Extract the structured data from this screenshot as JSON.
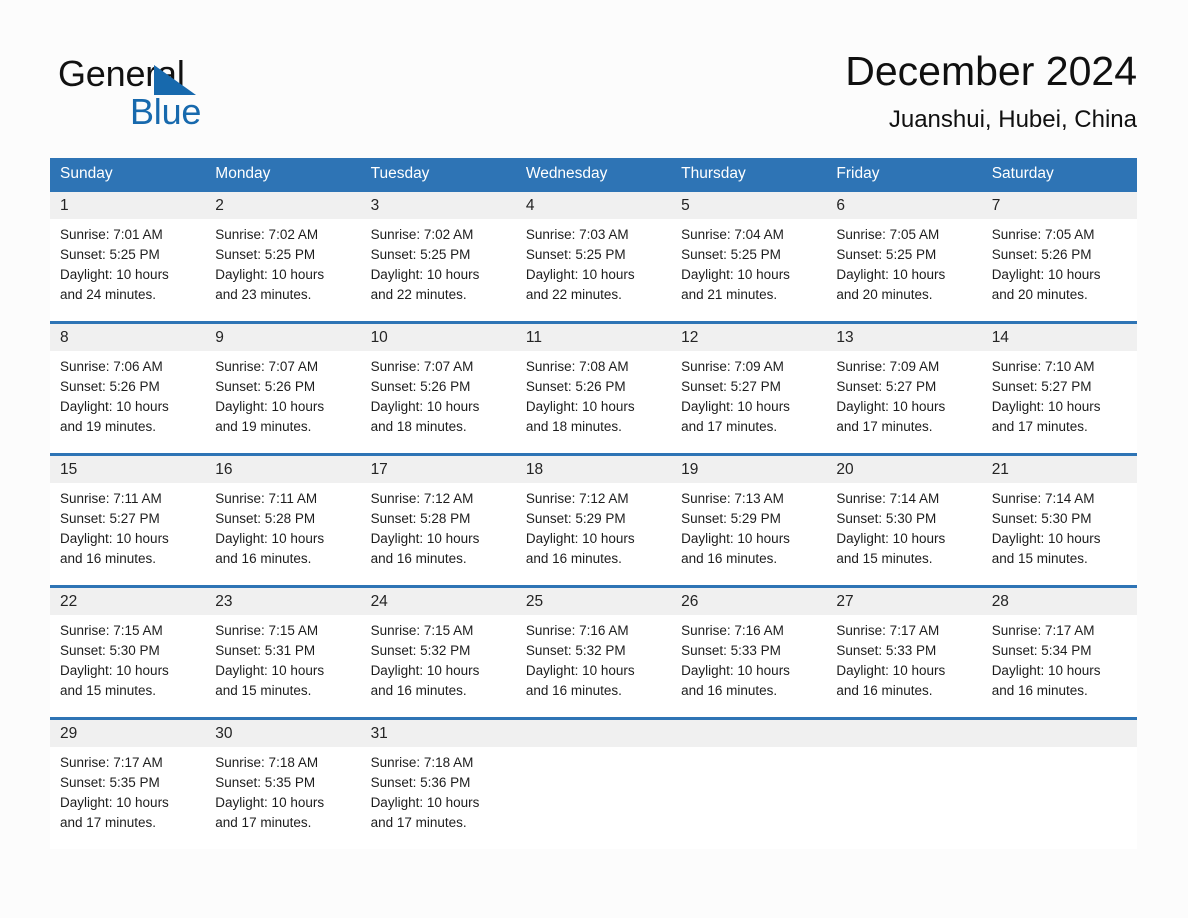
{
  "brand": {
    "name_part1": "General",
    "name_part2": "Blue",
    "triangle_color": "#1769ad"
  },
  "header": {
    "title": "December 2024",
    "subtitle": "Juanshui, Hubei, China"
  },
  "theme": {
    "header_blue": "#2e74b5",
    "daynum_band": "#f0f0f0",
    "page_background": "#fcfcfc",
    "text": "#1d1d1d"
  },
  "calendar": {
    "weekdays": [
      "Sunday",
      "Monday",
      "Tuesday",
      "Wednesday",
      "Thursday",
      "Friday",
      "Saturday"
    ],
    "weeks": [
      [
        {
          "day": "1",
          "sunrise": "Sunrise: 7:01 AM",
          "sunset": "Sunset: 5:25 PM",
          "daylight_l1": "Daylight: 10 hours",
          "daylight_l2": "and 24 minutes."
        },
        {
          "day": "2",
          "sunrise": "Sunrise: 7:02 AM",
          "sunset": "Sunset: 5:25 PM",
          "daylight_l1": "Daylight: 10 hours",
          "daylight_l2": "and 23 minutes."
        },
        {
          "day": "3",
          "sunrise": "Sunrise: 7:02 AM",
          "sunset": "Sunset: 5:25 PM",
          "daylight_l1": "Daylight: 10 hours",
          "daylight_l2": "and 22 minutes."
        },
        {
          "day": "4",
          "sunrise": "Sunrise: 7:03 AM",
          "sunset": "Sunset: 5:25 PM",
          "daylight_l1": "Daylight: 10 hours",
          "daylight_l2": "and 22 minutes."
        },
        {
          "day": "5",
          "sunrise": "Sunrise: 7:04 AM",
          "sunset": "Sunset: 5:25 PM",
          "daylight_l1": "Daylight: 10 hours",
          "daylight_l2": "and 21 minutes."
        },
        {
          "day": "6",
          "sunrise": "Sunrise: 7:05 AM",
          "sunset": "Sunset: 5:25 PM",
          "daylight_l1": "Daylight: 10 hours",
          "daylight_l2": "and 20 minutes."
        },
        {
          "day": "7",
          "sunrise": "Sunrise: 7:05 AM",
          "sunset": "Sunset: 5:26 PM",
          "daylight_l1": "Daylight: 10 hours",
          "daylight_l2": "and 20 minutes."
        }
      ],
      [
        {
          "day": "8",
          "sunrise": "Sunrise: 7:06 AM",
          "sunset": "Sunset: 5:26 PM",
          "daylight_l1": "Daylight: 10 hours",
          "daylight_l2": "and 19 minutes."
        },
        {
          "day": "9",
          "sunrise": "Sunrise: 7:07 AM",
          "sunset": "Sunset: 5:26 PM",
          "daylight_l1": "Daylight: 10 hours",
          "daylight_l2": "and 19 minutes."
        },
        {
          "day": "10",
          "sunrise": "Sunrise: 7:07 AM",
          "sunset": "Sunset: 5:26 PM",
          "daylight_l1": "Daylight: 10 hours",
          "daylight_l2": "and 18 minutes."
        },
        {
          "day": "11",
          "sunrise": "Sunrise: 7:08 AM",
          "sunset": "Sunset: 5:26 PM",
          "daylight_l1": "Daylight: 10 hours",
          "daylight_l2": "and 18 minutes."
        },
        {
          "day": "12",
          "sunrise": "Sunrise: 7:09 AM",
          "sunset": "Sunset: 5:27 PM",
          "daylight_l1": "Daylight: 10 hours",
          "daylight_l2": "and 17 minutes."
        },
        {
          "day": "13",
          "sunrise": "Sunrise: 7:09 AM",
          "sunset": "Sunset: 5:27 PM",
          "daylight_l1": "Daylight: 10 hours",
          "daylight_l2": "and 17 minutes."
        },
        {
          "day": "14",
          "sunrise": "Sunrise: 7:10 AM",
          "sunset": "Sunset: 5:27 PM",
          "daylight_l1": "Daylight: 10 hours",
          "daylight_l2": "and 17 minutes."
        }
      ],
      [
        {
          "day": "15",
          "sunrise": "Sunrise: 7:11 AM",
          "sunset": "Sunset: 5:27 PM",
          "daylight_l1": "Daylight: 10 hours",
          "daylight_l2": "and 16 minutes."
        },
        {
          "day": "16",
          "sunrise": "Sunrise: 7:11 AM",
          "sunset": "Sunset: 5:28 PM",
          "daylight_l1": "Daylight: 10 hours",
          "daylight_l2": "and 16 minutes."
        },
        {
          "day": "17",
          "sunrise": "Sunrise: 7:12 AM",
          "sunset": "Sunset: 5:28 PM",
          "daylight_l1": "Daylight: 10 hours",
          "daylight_l2": "and 16 minutes."
        },
        {
          "day": "18",
          "sunrise": "Sunrise: 7:12 AM",
          "sunset": "Sunset: 5:29 PM",
          "daylight_l1": "Daylight: 10 hours",
          "daylight_l2": "and 16 minutes."
        },
        {
          "day": "19",
          "sunrise": "Sunrise: 7:13 AM",
          "sunset": "Sunset: 5:29 PM",
          "daylight_l1": "Daylight: 10 hours",
          "daylight_l2": "and 16 minutes."
        },
        {
          "day": "20",
          "sunrise": "Sunrise: 7:14 AM",
          "sunset": "Sunset: 5:30 PM",
          "daylight_l1": "Daylight: 10 hours",
          "daylight_l2": "and 15 minutes."
        },
        {
          "day": "21",
          "sunrise": "Sunrise: 7:14 AM",
          "sunset": "Sunset: 5:30 PM",
          "daylight_l1": "Daylight: 10 hours",
          "daylight_l2": "and 15 minutes."
        }
      ],
      [
        {
          "day": "22",
          "sunrise": "Sunrise: 7:15 AM",
          "sunset": "Sunset: 5:30 PM",
          "daylight_l1": "Daylight: 10 hours",
          "daylight_l2": "and 15 minutes."
        },
        {
          "day": "23",
          "sunrise": "Sunrise: 7:15 AM",
          "sunset": "Sunset: 5:31 PM",
          "daylight_l1": "Daylight: 10 hours",
          "daylight_l2": "and 15 minutes."
        },
        {
          "day": "24",
          "sunrise": "Sunrise: 7:15 AM",
          "sunset": "Sunset: 5:32 PM",
          "daylight_l1": "Daylight: 10 hours",
          "daylight_l2": "and 16 minutes."
        },
        {
          "day": "25",
          "sunrise": "Sunrise: 7:16 AM",
          "sunset": "Sunset: 5:32 PM",
          "daylight_l1": "Daylight: 10 hours",
          "daylight_l2": "and 16 minutes."
        },
        {
          "day": "26",
          "sunrise": "Sunrise: 7:16 AM",
          "sunset": "Sunset: 5:33 PM",
          "daylight_l1": "Daylight: 10 hours",
          "daylight_l2": "and 16 minutes."
        },
        {
          "day": "27",
          "sunrise": "Sunrise: 7:17 AM",
          "sunset": "Sunset: 5:33 PM",
          "daylight_l1": "Daylight: 10 hours",
          "daylight_l2": "and 16 minutes."
        },
        {
          "day": "28",
          "sunrise": "Sunrise: 7:17 AM",
          "sunset": "Sunset: 5:34 PM",
          "daylight_l1": "Daylight: 10 hours",
          "daylight_l2": "and 16 minutes."
        }
      ],
      [
        {
          "day": "29",
          "sunrise": "Sunrise: 7:17 AM",
          "sunset": "Sunset: 5:35 PM",
          "daylight_l1": "Daylight: 10 hours",
          "daylight_l2": "and 17 minutes."
        },
        {
          "day": "30",
          "sunrise": "Sunrise: 7:18 AM",
          "sunset": "Sunset: 5:35 PM",
          "daylight_l1": "Daylight: 10 hours",
          "daylight_l2": "and 17 minutes."
        },
        {
          "day": "31",
          "sunrise": "Sunrise: 7:18 AM",
          "sunset": "Sunset: 5:36 PM",
          "daylight_l1": "Daylight: 10 hours",
          "daylight_l2": "and 17 minutes."
        },
        {
          "day": "",
          "sunrise": "",
          "sunset": "",
          "daylight_l1": "",
          "daylight_l2": ""
        },
        {
          "day": "",
          "sunrise": "",
          "sunset": "",
          "daylight_l1": "",
          "daylight_l2": ""
        },
        {
          "day": "",
          "sunrise": "",
          "sunset": "",
          "daylight_l1": "",
          "daylight_l2": ""
        },
        {
          "day": "",
          "sunrise": "",
          "sunset": "",
          "daylight_l1": "",
          "daylight_l2": ""
        }
      ]
    ]
  }
}
